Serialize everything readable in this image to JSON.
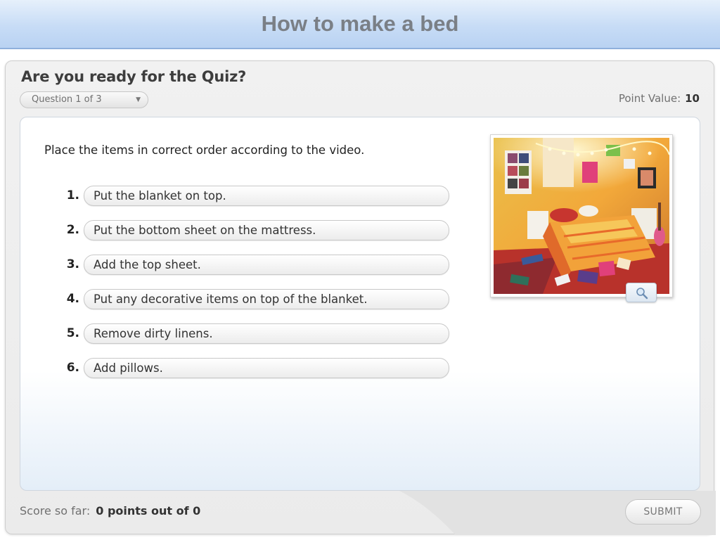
{
  "banner": {
    "title": "How to make a bed"
  },
  "quiz": {
    "heading": "Are you ready for the Quiz?",
    "question_selector": {
      "selected": "Question 1 of 3"
    },
    "point_value_label": "Point Value:",
    "point_value": "10",
    "instructions": "Place the items in correct order according to the video.",
    "items": [
      {
        "number": "1.",
        "label": "Put the blanket on top."
      },
      {
        "number": "2.",
        "label": "Put the bottom sheet on the mattress."
      },
      {
        "number": "3.",
        "label": "Add the top sheet."
      },
      {
        "number": "4.",
        "label": "Put any decorative items on top of the blanket."
      },
      {
        "number": "5.",
        "label": "Remove dirty linens."
      },
      {
        "number": "6.",
        "label": "Add pillows."
      }
    ],
    "image_zoom_icon": "magnifier-icon",
    "score_label": "Score so far:",
    "score_value": "0 points out of 0",
    "submit_label": "SUBMIT"
  },
  "colors": {
    "banner_bg": "#c7dcf6",
    "banner_text": "#7a7f86",
    "frame_bg": "#ededed",
    "panel_bottom": "#e4eef8"
  }
}
